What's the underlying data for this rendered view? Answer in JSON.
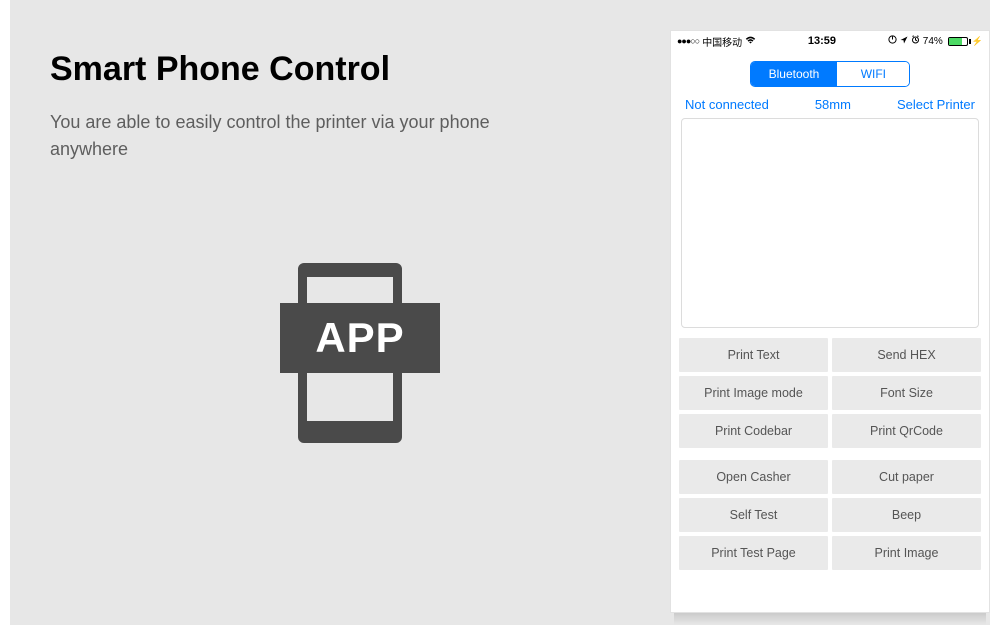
{
  "promo": {
    "headline": "Smart Phone Control",
    "subtext": "You are able to easily control the printer via your phone anywhere",
    "app_label": "APP"
  },
  "statusbar": {
    "carrier": "中国移动",
    "time": "13:59",
    "battery_pct": "74%"
  },
  "segmented": {
    "bluetooth": "Bluetooth",
    "wifi": "WIFI"
  },
  "info": {
    "status": "Not connected",
    "paper": "58mm",
    "select": "Select Printer"
  },
  "buttons_group1": [
    "Print Text",
    "Send HEX",
    "Print Image mode",
    "Font Size",
    "Print Codebar",
    "Print QrCode"
  ],
  "buttons_group2": [
    "Open Casher",
    "Cut paper",
    "Self Test",
    "Beep",
    "Print Test Page",
    "Print Image"
  ]
}
